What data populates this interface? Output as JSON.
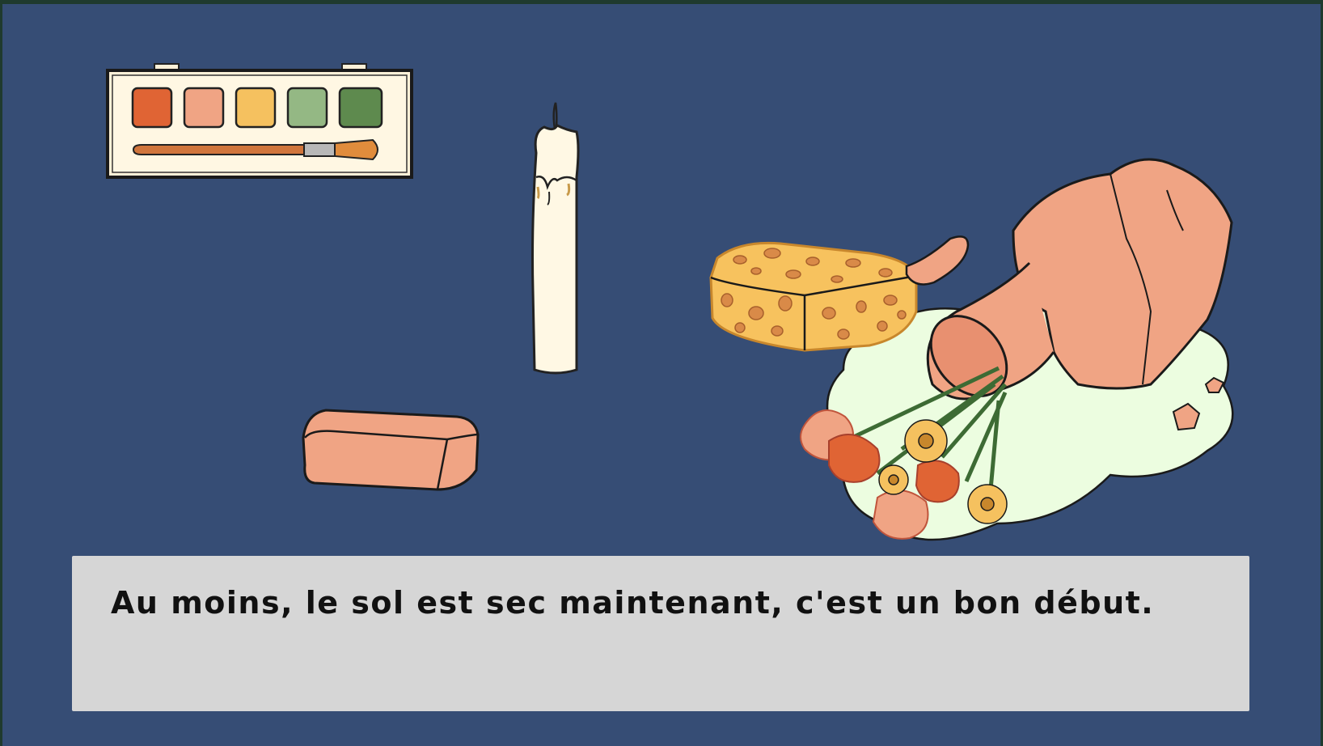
{
  "dialogue": {
    "text": "Au moins, le sol est sec maintenant, c'est un bon début."
  },
  "scene_items": [
    {
      "name": "watercolor-palette",
      "icon": "watercolor-palette-icon"
    },
    {
      "name": "candle",
      "icon": "candle-icon"
    },
    {
      "name": "sponge",
      "icon": "sponge-icon"
    },
    {
      "name": "clay-brick",
      "icon": "clay-brick-icon"
    },
    {
      "name": "broken-vase-with-flowers",
      "icon": "broken-vase-icon"
    }
  ],
  "colors": {
    "background": "#364d75",
    "dialogue_box": "#d6d6d6",
    "dialogue_text": "#111111",
    "terracotta": "#f0a484",
    "water_puddle": "#ecfde0",
    "sponge": "#f7c25e",
    "candle_wax": "#fff8e4"
  }
}
